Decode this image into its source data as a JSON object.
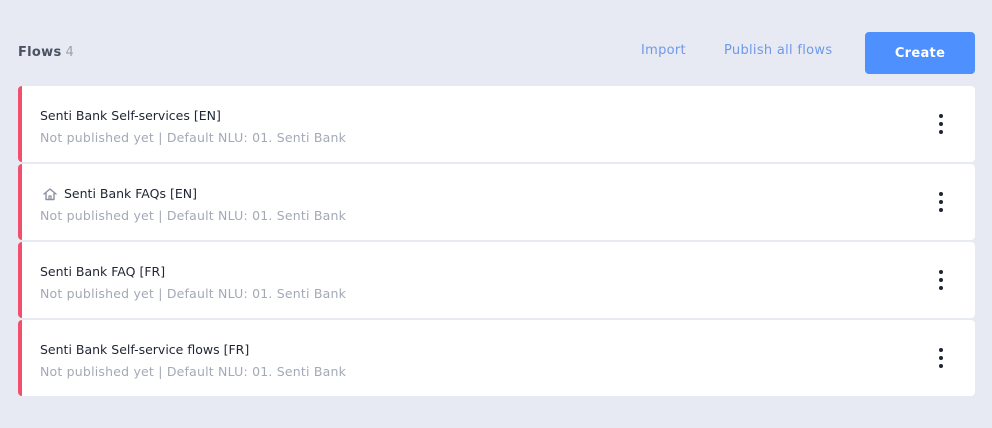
{
  "header": {
    "title": "Flows",
    "count": "4",
    "import_label": "Import",
    "publish_label": "Publish all flows",
    "create_label": "Create"
  },
  "colors": {
    "accent": "#4d90fe",
    "unpublished_bar": "#f0506e",
    "link": "#6f98e8",
    "background": "#e8eaf3"
  },
  "flows": [
    {
      "name": "Senti Bank Self-services [EN]",
      "status": "Not published yet",
      "nlu": "Default NLU: 01. Senti Bank",
      "icon": null
    },
    {
      "name": "Senti Bank FAQs [EN]",
      "status": "Not published yet",
      "nlu": "Default NLU: 01. Senti Bank",
      "icon": "home-icon"
    },
    {
      "name": "Senti Bank FAQ [FR]",
      "status": "Not published yet",
      "nlu": "Default NLU: 01. Senti Bank",
      "icon": null
    },
    {
      "name": "Senti Bank Self-service flows [FR]",
      "status": "Not published yet",
      "nlu": "Default NLU: 01. Senti Bank",
      "icon": null
    }
  ]
}
